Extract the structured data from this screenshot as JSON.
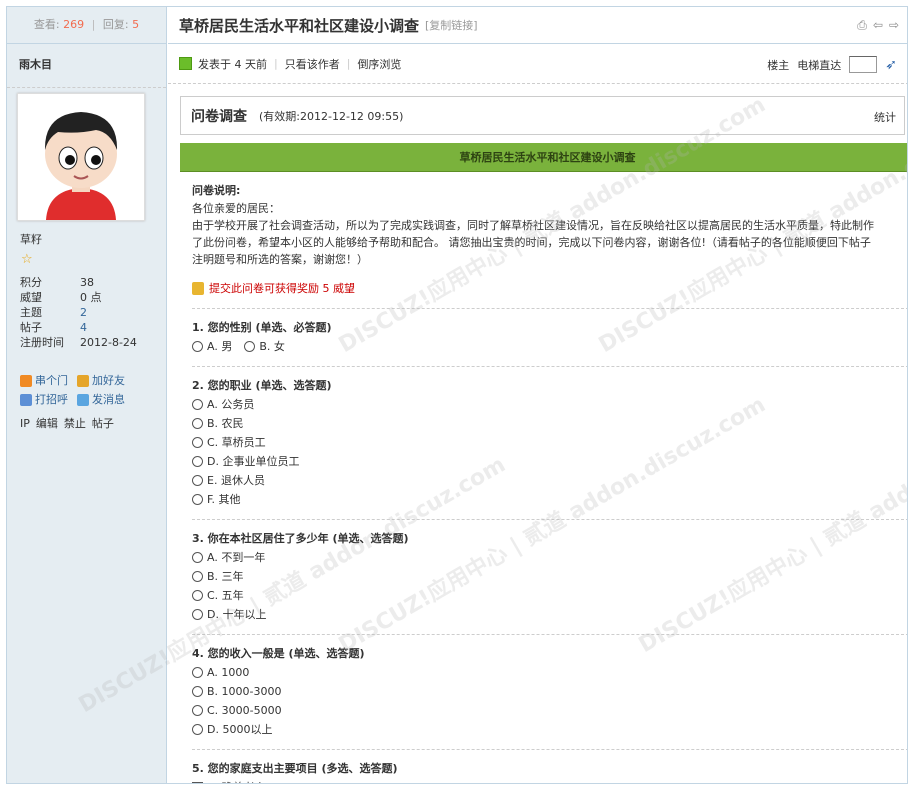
{
  "sidebar": {
    "views_label": "查看:",
    "views": "269",
    "replies_label": "回复:",
    "replies": "5",
    "author": "雨木目",
    "group": "草籽",
    "stats": [
      {
        "k": "积分",
        "v": "38",
        "link": false
      },
      {
        "k": "威望",
        "v": "0 点",
        "link": false
      },
      {
        "k": "主题",
        "v": "2",
        "link": true
      },
      {
        "k": "帖子",
        "v": "4",
        "link": true
      },
      {
        "k": "注册时间",
        "v": "2012-8-24",
        "link": false
      }
    ],
    "actions": [
      {
        "label": "串个门",
        "icon": "house-icon",
        "color": "#f08a24"
      },
      {
        "label": "加好友",
        "icon": "add-friend-icon",
        "color": "#e5a52a"
      },
      {
        "label": "打招呼",
        "icon": "greet-icon",
        "color": "#5c8fd6"
      },
      {
        "label": "发消息",
        "icon": "message-icon",
        "color": "#5aa5e0"
      }
    ],
    "admin": [
      "IP",
      "编辑",
      "禁止",
      "帖子"
    ]
  },
  "header": {
    "title": "草桥居民生活水平和社区建设小调查",
    "copy_link": "[复制链接]"
  },
  "postinfo": {
    "posted": "发表于 4 天前",
    "only_author": "只看该作者",
    "reverse": "倒序浏览",
    "floor": "楼主",
    "elevator": "电梯直达"
  },
  "poll": {
    "heading": "问卷调查",
    "expiry": "(有效期:2012-12-12 09:55)",
    "stats": "统计"
  },
  "survey": {
    "title": "草桥居民生活水平和社区建设小调查",
    "desc_title": "问卷说明:",
    "desc_lines": [
      "各位亲爱的居民：",
      "由于学校开展了社会调查活动，所以为了完成实践调查，同时了解草桥社区建设情况，旨在反映给社区以提高居民的生活水平质量，特此制作",
      "了此份问卷，希望本小区的人能够给予帮助和配合。  请您抽出宝贵的时间，完成以下问卷内容，谢谢各位!（请看帖子的各位能顺便回下帖子",
      "注明题号和所选的答案，谢谢您！）"
    ],
    "reward": "提交此问卷可获得奖励 5 威望",
    "questions": [
      {
        "title": "1. 您的性别 (单选、必答题)",
        "type": "radio",
        "inline": true,
        "options": [
          "A. 男",
          "B. 女"
        ]
      },
      {
        "title": "2. 您的职业 (单选、选答题)",
        "type": "radio",
        "inline": false,
        "options": [
          "A. 公务员",
          "B. 农民",
          "C. 草桥员工",
          "D. 企事业单位员工",
          "E. 退休人员",
          "F. 其他"
        ]
      },
      {
        "title": "3. 你在本社区居住了多少年 (单选、选答题)",
        "type": "radio",
        "inline": false,
        "options": [
          "A. 不到一年",
          "B. 三年",
          "C. 五年",
          "D. 十年以上"
        ]
      },
      {
        "title": "4. 您的收入一般是 (单选、选答题)",
        "type": "radio",
        "inline": false,
        "options": [
          "A. 1000",
          "B. 1000-3000",
          "C. 3000-5000",
          "D. 5000以上"
        ]
      },
      {
        "title": "5. 您的家庭支出主要项目 (多选、选答题)",
        "type": "check",
        "inline": false,
        "options": [
          "A. 赡养老人"
        ]
      }
    ]
  },
  "watermark": "DISCUZ!应用中心 | 贰道 addon.discuz.com"
}
